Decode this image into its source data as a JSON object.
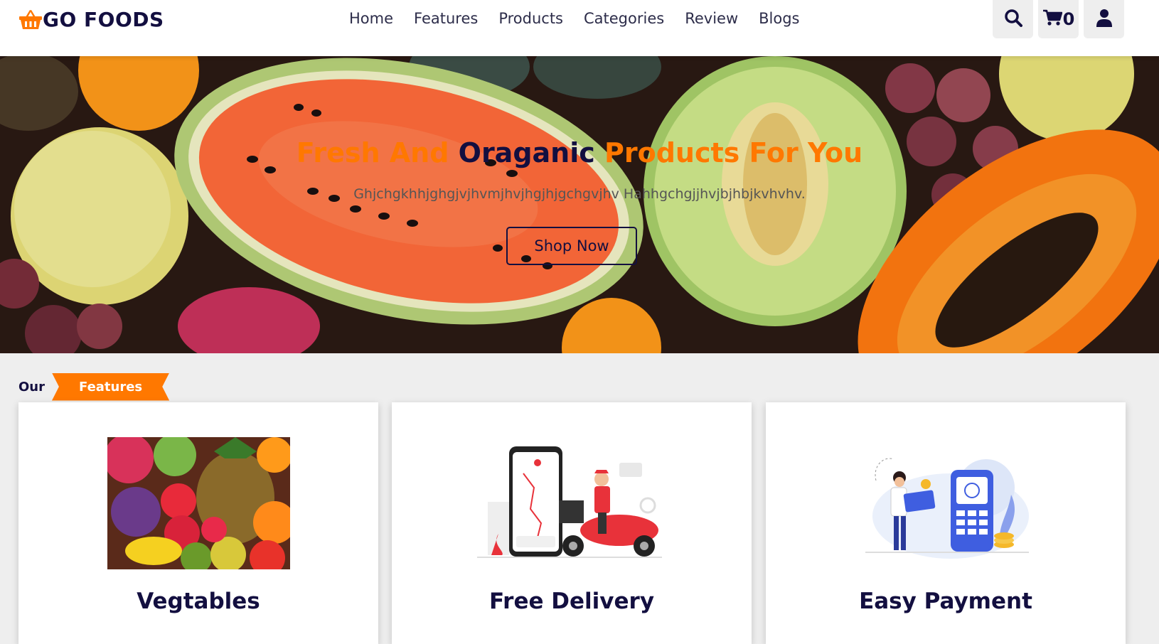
{
  "header": {
    "logo_text": "GO FOODS",
    "nav": [
      "Home",
      "Features",
      "Products",
      "Categories",
      "Review",
      "Blogs"
    ],
    "cart_count": "0",
    "icons": [
      "search-icon",
      "cart-icon",
      "user-icon"
    ]
  },
  "hero": {
    "title_part1": "Fresh And ",
    "title_part2": "Oraganic",
    "title_part3": " Products For You",
    "description": "Ghjchgkhhjghgjvjhvmjhvjhgjhjgchgvjhv Hahhgchgjjhvjbjhbjkvhvhv.",
    "button": "Shop Now"
  },
  "features": {
    "heading_prefix": "Our",
    "heading_tag": "Features",
    "cards": [
      {
        "title": "Vegtables"
      },
      {
        "title": "Free Delivery"
      },
      {
        "title": "Easy Payment"
      }
    ]
  },
  "colors": {
    "accent": "#ff7800",
    "dark": "#130f40"
  }
}
